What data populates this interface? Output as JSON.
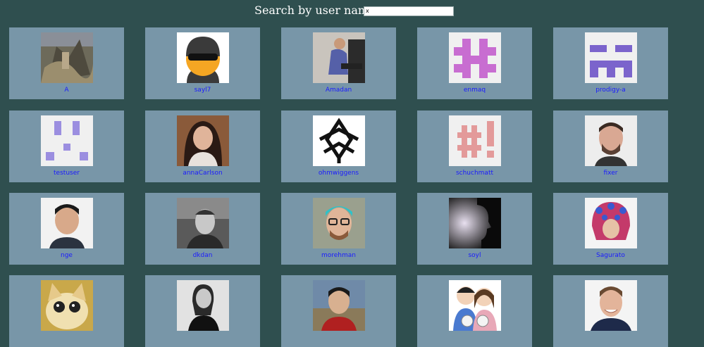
{
  "header": {
    "label": "Search by user name",
    "search_value": "x"
  },
  "users": [
    {
      "name": "A",
      "avatar": "painting-photo"
    },
    {
      "name": "sayl7",
      "avatar": "robber-emoji"
    },
    {
      "name": "Amadan",
      "avatar": "presenter-photo"
    },
    {
      "name": "enmaq",
      "avatar": "identicon-pink"
    },
    {
      "name": "prodigy-a",
      "avatar": "identicon-purple"
    },
    {
      "name": "testuser",
      "avatar": "identicon-lavender"
    },
    {
      "name": "annaCarlson",
      "avatar": "woman-photo"
    },
    {
      "name": "ohmwiggens",
      "avatar": "black-emblem"
    },
    {
      "name": "schuchmatt",
      "avatar": "hash-bang-icon"
    },
    {
      "name": "fixer",
      "avatar": "man-photo"
    },
    {
      "name": "nge",
      "avatar": "man-glasses-photo"
    },
    {
      "name": "dkdan",
      "avatar": "bw-man-photo"
    },
    {
      "name": "morehman",
      "avatar": "blue-hair-photo"
    },
    {
      "name": "soyl",
      "avatar": "silhouette-photo"
    },
    {
      "name": "Sagurato",
      "avatar": "hat-person-photo"
    },
    {
      "name": "",
      "avatar": "cat-photo"
    },
    {
      "name": "",
      "avatar": "bw-woman-photo"
    },
    {
      "name": "",
      "avatar": "red-jacket-photo"
    },
    {
      "name": "",
      "avatar": "cartoon-couple"
    },
    {
      "name": "",
      "avatar": "smiling-man-photo"
    }
  ]
}
